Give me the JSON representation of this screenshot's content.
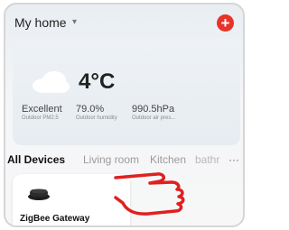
{
  "header": {
    "home_title": "My home",
    "dropdown_glyph": "▾",
    "add_glyph": "+",
    "add_color": "#e8332b"
  },
  "weather": {
    "icon": "cloud-icon",
    "temperature": "4°C",
    "stats": [
      {
        "value": "Excellent",
        "label": "Outdoor PM2.5"
      },
      {
        "value": "79.0%",
        "label": "Outdoor humidity"
      },
      {
        "value": "990.5hPa",
        "label": "Outdoor air pres..."
      }
    ]
  },
  "tabs": {
    "items": [
      "All Devices",
      "Living room",
      "Kitchen",
      "bathr"
    ],
    "more_glyph": "···",
    "selected": "All Devices"
  },
  "devices": [
    {
      "name": "ZigBee Gateway",
      "icon": "gateway-icon"
    }
  ],
  "annotation": {
    "icon": "pointing-hand-icon",
    "color": "#e02020"
  }
}
